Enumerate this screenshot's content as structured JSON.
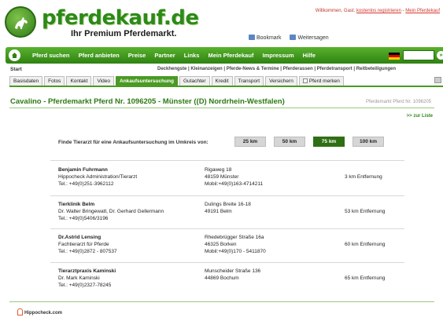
{
  "header": {
    "logo_text": "pferdekauf.de",
    "slogan": "Ihr Premium Pferdemarkt.",
    "welcome_prefix": "Willkommen, Gast.",
    "login_link": "kostenlos registrieren",
    "separator": "-",
    "my_link": "Mein Pferdekauf",
    "bookmark_label": "Bookmark",
    "recommend_label": "Weitersagen"
  },
  "nav": {
    "items": [
      "Pferd suchen",
      "Pferd anbieten",
      "Preise",
      "Partner",
      "Links",
      "Mein Pferdekauf",
      "Impressum",
      "Hilfe"
    ],
    "go_label": "»"
  },
  "subnav": {
    "start": "Start",
    "links": "Deckhengste | Kleinanzeigen | Pferde-News & Termine | Pferderassen | Pferdetransport | Reitbeteiligungen"
  },
  "tabs": [
    {
      "label": "Basisdaten"
    },
    {
      "label": "Fotos"
    },
    {
      "label": "Kontakt"
    },
    {
      "label": "Video"
    },
    {
      "label": "Ankaufsuntersuchung"
    },
    {
      "label": "Gutachter"
    },
    {
      "label": "Kredit"
    },
    {
      "label": "Transport"
    },
    {
      "label": "Versichern"
    },
    {
      "label": "Pferd merken"
    }
  ],
  "listing": {
    "title": "Cavalino - Pferdemarkt Pferd Nr. 1096205 - Münster ((D) Nordrhein-Westfalen)",
    "ref": "Pferdemarkt Pferd Nr. 1096205",
    "back_link": ">> zur Liste"
  },
  "filter": {
    "label": "Finde Tierarzt für eine Ankaufsuntersuchung im Umkreis von:",
    "options": [
      "25 km",
      "50 km",
      "75 km",
      "100 km"
    ],
    "selected": "75 km"
  },
  "results": [
    {
      "name": "Benjamin Fuhrmann",
      "line2": "Hippocheck Administration/Tierarzt",
      "phone": "Tel.: +49(0)251-3962112",
      "street": "Rigaweg 18",
      "city": "48159 Münster",
      "extra": "Mobil:+49(0)163-4714211",
      "distance": "3 km Entfernung"
    },
    {
      "name": "Tierklinik Belm",
      "line2": "Dr. Walter Bringewatt, Dr. Gerhard Gellermann",
      "phone": "Tel.: +49(0)5406/3196",
      "street": "Dulings Breite 16-18",
      "city": "49191 Belm",
      "extra": "",
      "distance": "53 km Entfernung"
    },
    {
      "name": "Dr.Astrid Lensing",
      "line2": "Fachtierarzt für Pferde",
      "phone": "Tel.: +49(0)2872 - 807537",
      "street": "Rhedebrügger Straße 16a",
      "city": "46325 Borken",
      "extra": "Mobil:+49(0)170 - 5411870",
      "distance": "60 km Entfernung"
    },
    {
      "name": "Tierarztpraxis Kaminski",
      "line2": "Dr. Mark Kaminski",
      "phone": "Tel.: +49(0)2327-78245",
      "street": "Munscheider Straße 136",
      "city": "44869 Bochum",
      "extra": "",
      "distance": "65 km Entfernung"
    }
  ],
  "footer": {
    "logo_text": "Hippocheck.com"
  }
}
